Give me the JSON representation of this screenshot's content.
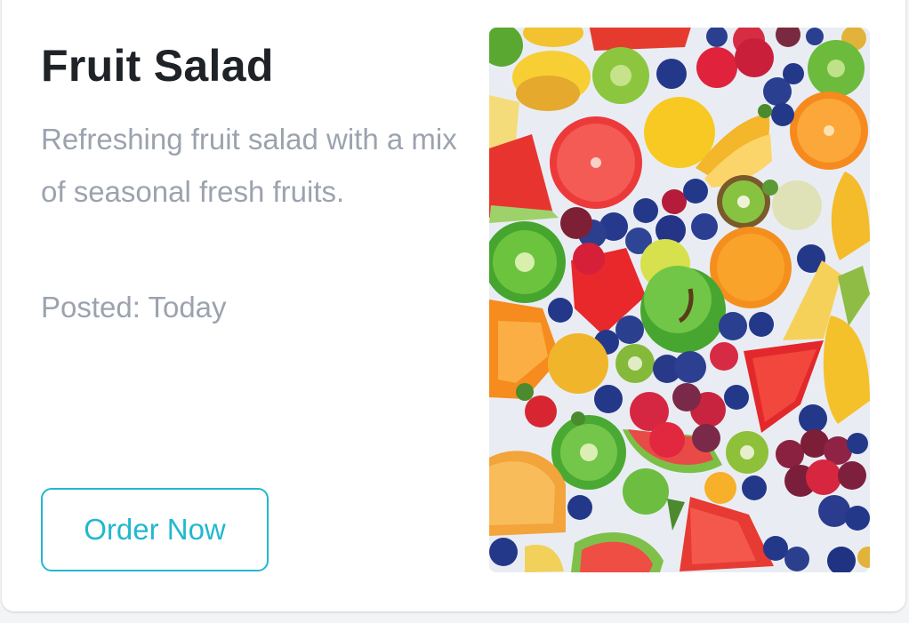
{
  "card": {
    "title": "Fruit Salad",
    "description": "Refreshing fruit salad with a mix of seasonal fresh fruits.",
    "posted": "Posted: Today",
    "order_label": "Order Now",
    "image_alt": "Fruit Salad"
  },
  "colors": {
    "accent": "#22b8cf",
    "title": "#1f2328",
    "muted": "#9ca3af"
  }
}
